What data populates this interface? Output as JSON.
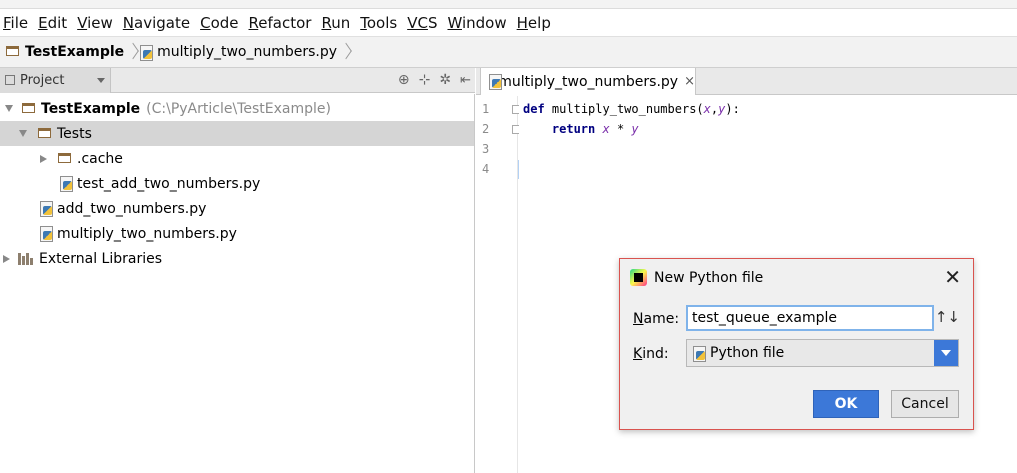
{
  "menu": {
    "items": [
      {
        "label_first": "F",
        "label_rest": "ile"
      },
      {
        "label_first": "E",
        "label_rest": "dit"
      },
      {
        "label_first": "V",
        "label_rest": "iew"
      },
      {
        "label_first": "N",
        "label_rest": "avigate"
      },
      {
        "label_first": "C",
        "label_rest": "ode"
      },
      {
        "label_first": "R",
        "label_rest": "efactor"
      },
      {
        "label_first": "R",
        "label_rest": "un"
      },
      {
        "label_first": "T",
        "label_rest": "ools"
      },
      {
        "label_first": "VC",
        "label_rest": "S"
      },
      {
        "label_first": "W",
        "label_rest": "indow"
      },
      {
        "label_first": "H",
        "label_rest": "elp"
      }
    ]
  },
  "breadcrumb": {
    "project": "TestExample",
    "file": "multiply_two_numbers.py"
  },
  "project_panel": {
    "selector_label": "Project",
    "tree": {
      "root_name": "TestExample",
      "root_path": "(C:\\PyArticle\\TestExample)",
      "tests_folder": "Tests",
      "cache_folder": ".cache",
      "test_file": "test_add_two_numbers.py",
      "add_file": "add_two_numbers.py",
      "multiply_file": "multiply_two_numbers.py",
      "external_libraries": "External Libraries"
    }
  },
  "editor": {
    "tab_label": "multiply_two_numbers.py",
    "tab_close": "×",
    "line_numbers": [
      "1",
      "2",
      "3",
      "4"
    ],
    "line1": {
      "kw": "def",
      "fn": "multiply_two_numbers",
      "open": "(",
      "p1": "x",
      "comma": ",",
      "p2": "y",
      "close": "):"
    },
    "line2": {
      "kw": "return",
      "a": "x",
      "op": " * ",
      "b": "y"
    }
  },
  "dialog": {
    "title": "New Python file",
    "close": "✕",
    "name_label_first": "N",
    "name_label_rest": "ame:",
    "name_value": "test_queue_example",
    "sort_glyph": "↑↓",
    "kind_label_first": "K",
    "kind_label_rest": "ind:",
    "kind_value": "Python file",
    "ok_label": "OK",
    "cancel_label": "Cancel"
  },
  "colors": {
    "caret_line": "#b3d1f5",
    "primary_button": "#3c78d8",
    "dialog_border": "#d9534f",
    "keyword": "#000080",
    "parameter": "#7a2faa"
  }
}
